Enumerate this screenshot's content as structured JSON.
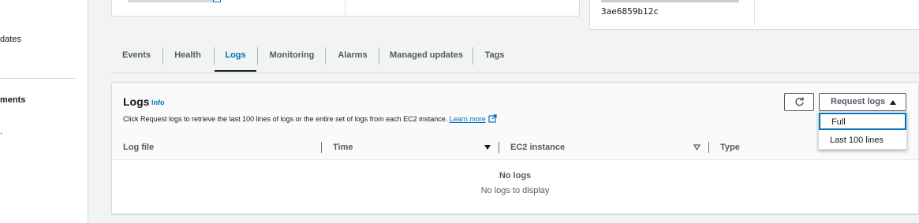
{
  "sidebar": {
    "items": [
      {
        "label": "dates"
      },
      {
        "label": "ments"
      },
      {
        "label": "."
      }
    ]
  },
  "environment_card": {
    "instance_hash_tail": "3ae6859b12c"
  },
  "tabs": [
    {
      "label": "Events"
    },
    {
      "label": "Health"
    },
    {
      "label": "Logs",
      "active": true
    },
    {
      "label": "Monitoring"
    },
    {
      "label": "Alarms"
    },
    {
      "label": "Managed updates"
    },
    {
      "label": "Tags"
    }
  ],
  "logs_panel": {
    "title": "Logs",
    "info_label": "Info",
    "description": "Click Request logs to retrieve the last 100 lines of logs or the entire set of logs from each EC2 instance.",
    "learn_more": "Learn more",
    "refresh_icon": "refresh-icon",
    "request_button": "Request logs",
    "columns": [
      "Log file",
      "Time",
      "EC2 instance",
      "Type"
    ],
    "empty_title": "No logs",
    "empty_subtitle": "No logs to display"
  },
  "request_menu": {
    "options": [
      "Full",
      "Last 100 lines"
    ],
    "selected": "Full"
  },
  "colors": {
    "accent": "#0073bb",
    "background": "#f2f3f3",
    "text": "#16191f",
    "muted": "#545b64"
  }
}
